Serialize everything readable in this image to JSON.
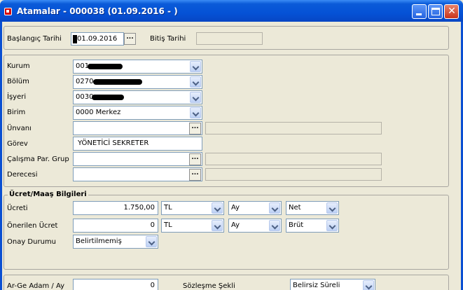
{
  "window": {
    "title": "Atamalar - 000038 (01.09.2016 -              )"
  },
  "dates": {
    "start_label": "Başlangıç Tarihi",
    "start_value": "01.09.2016",
    "end_label": "Bitiş Tarihi",
    "end_value": ""
  },
  "org": {
    "kurum_label": "Kurum",
    "kurum_value": "001",
    "bolum_label": "Bölüm",
    "bolum_value": "0270",
    "isyeri_label": "İşyeri",
    "isyeri_value": "0030",
    "birim_label": "Birim",
    "birim_value": "0000 Merkez",
    "unvan_label": "Ünvanı",
    "unvan_value": "",
    "gorev_label": "Görev",
    "gorev_value": "YÖNETİCİ SEKRETER",
    "calisma_label": "Çalışma Par. Grup",
    "calisma_value": "",
    "derece_label": "Derecesi",
    "derece_value": ""
  },
  "salary": {
    "section_title": "Ücret/Maaş Bilgileri",
    "ucret_label": "Ücreti",
    "ucret_value": "1.750,00",
    "ucret_currency": "TL",
    "ucret_period": "Ay",
    "ucret_type": "Net",
    "onerilen_label": "Önerilen Ücret",
    "onerilen_value": "0",
    "onerilen_currency": "TL",
    "onerilen_period": "Ay",
    "onerilen_type": "Brüt",
    "onay_label": "Onay Durumu",
    "onay_value": "Belirtilmemiş"
  },
  "extra": {
    "arge_label": "Ar-Ge Adam / Ay",
    "arge_value": "0",
    "sozlesme_label": "Sözleşme Şekli",
    "sozlesme_value": "Belirsiz Süreli"
  },
  "icons": {
    "ellipsis": "...",
    "window_icon": "app-icon"
  },
  "colors": {
    "title_bar": "#0552d6",
    "window_bg": "#ece9d8",
    "close_button": "#c9341b"
  }
}
